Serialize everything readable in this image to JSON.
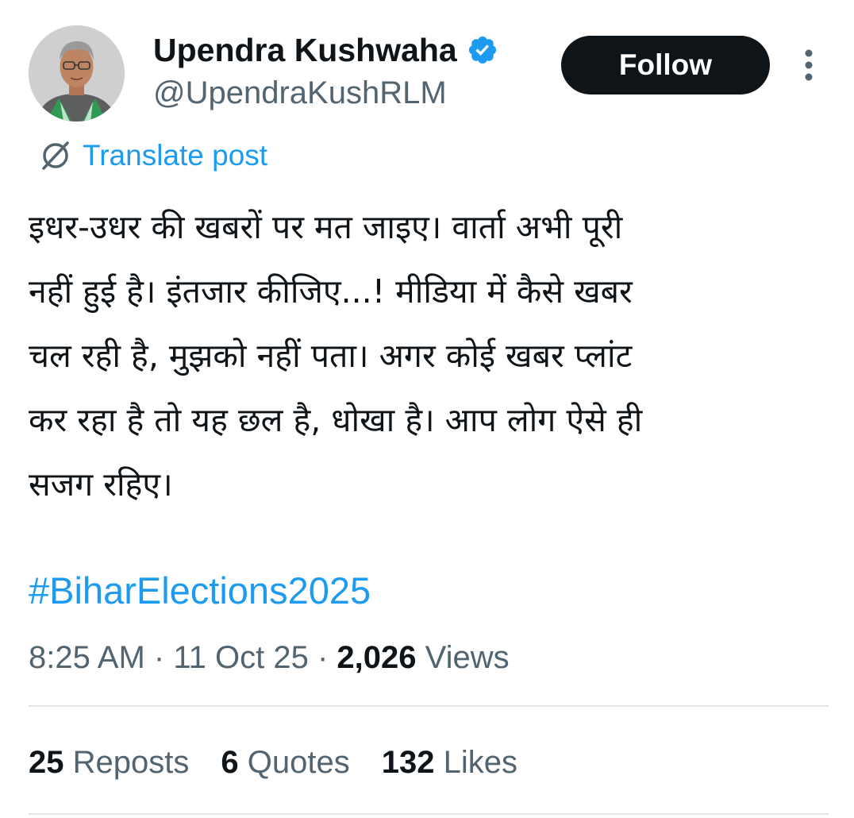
{
  "author": {
    "display_name": "Upendra Kushwaha",
    "handle": "@UpendraKushRLM",
    "verified": true
  },
  "actions": {
    "follow_label": "Follow"
  },
  "icons": {
    "verified": "verified-badge-icon",
    "more": "more-vertical-icon",
    "translate": "translate-globe-icon"
  },
  "translate": {
    "label": "Translate post"
  },
  "post": {
    "lines": [
      "इधर-उधर की खबरों पर मत जाइए। वार्ता अभी पूरी",
      "नहीं हुई है। इंतजार कीजिए...! मीडिया में कैसे खबर",
      "चल रही है, मुझको नहीं पता। अगर कोई खबर प्लांट",
      "कर रहा है तो यह छल है, धोखा है। आप लोग ऐसे ही",
      "सजग रहिए।"
    ],
    "hashtag": "#BiharElections2025"
  },
  "meta": {
    "time": "8:25 AM",
    "date": "11 Oct 25",
    "separator": "·",
    "views_count": "2,026",
    "views_label": "Views"
  },
  "stats": {
    "reposts": {
      "count": "25",
      "label": "Reposts"
    },
    "quotes": {
      "count": "6",
      "label": "Quotes"
    },
    "likes": {
      "count": "132",
      "label": "Likes"
    }
  },
  "colors": {
    "text": "#0f1419",
    "secondary": "#536471",
    "link": "#1d9bf0",
    "button_bg": "#0f1419",
    "divider": "#e1e6ea"
  }
}
